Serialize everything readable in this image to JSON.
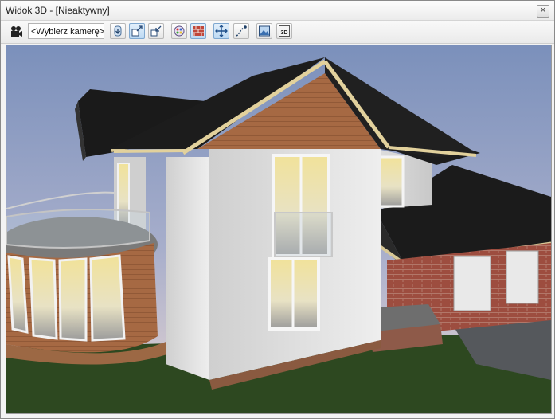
{
  "window": {
    "title": "Widok 3D - [Nieaktywny]",
    "close_glyph": "×"
  },
  "toolbar": {
    "camera_select_value": "<Wybierz kamerę>",
    "buttons": [
      {
        "name": "camera-dropdown-button",
        "icon": "arrow-down-icon"
      },
      {
        "name": "view-mode-button-1",
        "icon": "window-arrow-icon",
        "active": true
      },
      {
        "name": "view-mode-button-2",
        "icon": "window-arrow-icon"
      },
      {
        "name": "color-palette-button",
        "icon": "palette-icon"
      },
      {
        "name": "wall-texture-button",
        "icon": "brick-wall-icon",
        "active": true
      },
      {
        "name": "rotate-view-button",
        "icon": "move-arrows-icon",
        "active": true
      },
      {
        "name": "walk-path-button",
        "icon": "path-icon"
      },
      {
        "name": "render-image-button",
        "icon": "image-render-icon"
      },
      {
        "name": "export-3d-button",
        "icon": "3d-export-icon",
        "label": "3D"
      }
    ]
  },
  "scene": {
    "description_icon": "house-3d-view",
    "colors": {
      "sky_top": "#7e93bd",
      "sky_bottom": "#e2d2d2",
      "grass": "#2f4a21",
      "roof": "#1c1c1c",
      "plaster": "#dcdcdc",
      "wood": "#a86b46",
      "brick": "#9a4a3c"
    }
  }
}
